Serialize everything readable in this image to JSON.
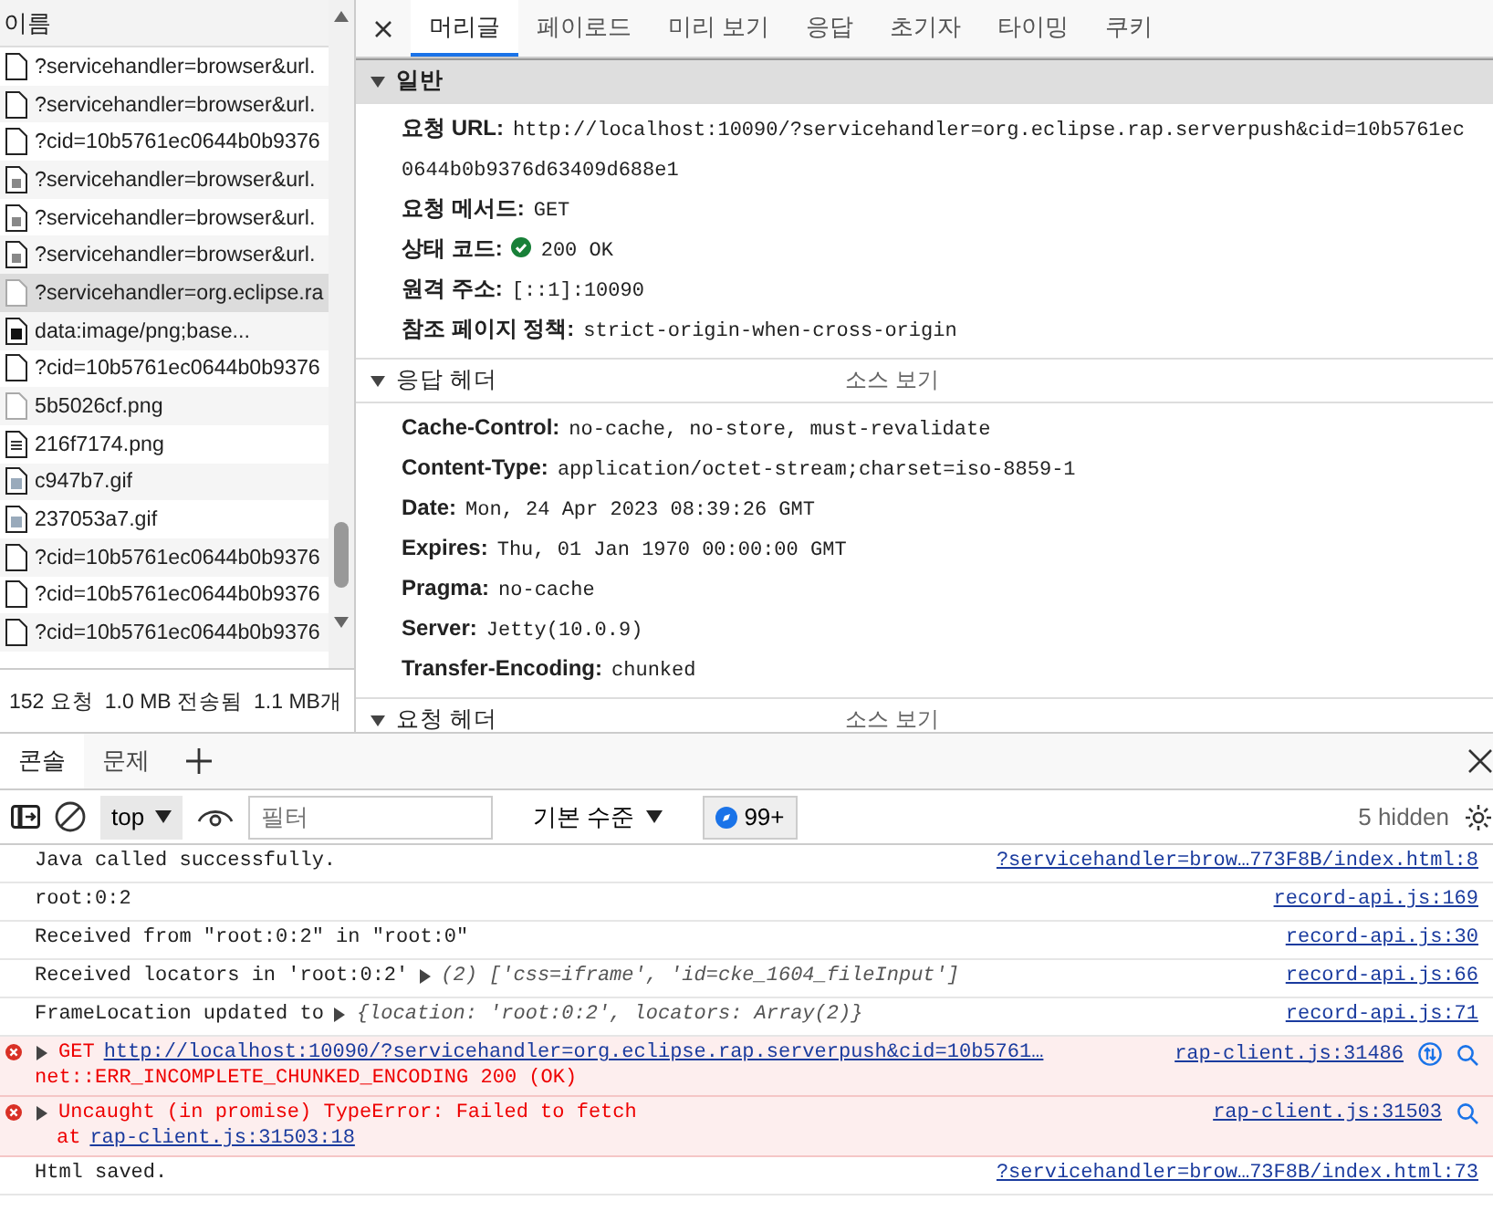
{
  "network": {
    "column_header": "이름",
    "files": [
      {
        "name": "?servicehandler=browser&url.",
        "kind": "doc",
        "selected": false
      },
      {
        "name": "?servicehandler=browser&url.",
        "kind": "doc",
        "selected": false
      },
      {
        "name": "?cid=10b5761ec0644b0b9376",
        "kind": "doc",
        "selected": false
      },
      {
        "name": "?servicehandler=browser&url.",
        "kind": "frame",
        "selected": false
      },
      {
        "name": "?servicehandler=browser&url.",
        "kind": "frame",
        "selected": false
      },
      {
        "name": "?servicehandler=browser&url.",
        "kind": "frame",
        "selected": false
      },
      {
        "name": "?servicehandler=org.eclipse.ra",
        "kind": "blank",
        "selected": true
      },
      {
        "name": "data:image/png;base...",
        "kind": "filled",
        "selected": false
      },
      {
        "name": "?cid=10b5761ec0644b0b9376",
        "kind": "doc",
        "selected": false
      },
      {
        "name": "5b5026cf.png",
        "kind": "blank",
        "selected": false
      },
      {
        "name": "216f7174.png",
        "kind": "text",
        "selected": false
      },
      {
        "name": "c947b7.gif",
        "kind": "image",
        "selected": false
      },
      {
        "name": "237053a7.gif",
        "kind": "image",
        "selected": false
      },
      {
        "name": "?cid=10b5761ec0644b0b9376",
        "kind": "doc",
        "selected": false
      },
      {
        "name": "?cid=10b5761ec0644b0b9376",
        "kind": "doc",
        "selected": false
      },
      {
        "name": "?cid=10b5761ec0644b0b9376",
        "kind": "doc",
        "selected": false
      }
    ],
    "status_bar": [
      "152 요청",
      "1.0 MB 전송됨",
      "1.1 MB개"
    ]
  },
  "details": {
    "tabs": [
      {
        "label": "머리글",
        "selected": true
      },
      {
        "label": "페이로드",
        "selected": false
      },
      {
        "label": "미리 보기",
        "selected": false
      },
      {
        "label": "응답",
        "selected": false
      },
      {
        "label": "초기자",
        "selected": false
      },
      {
        "label": "타이밍",
        "selected": false
      },
      {
        "label": "쿠키",
        "selected": false
      }
    ],
    "sections": [
      {
        "title": "일반",
        "expanded": true,
        "highlighted": true,
        "rows": [
          {
            "name": "요청 URL:",
            "value": "http://localhost:10090/?servicehandler=org.eclipse.rap.serverpush&cid=10b5761ec0644b0b9376d63409d688e1",
            "status_ok": false
          },
          {
            "name": "요청 메서드:",
            "value": "GET",
            "status_ok": false
          },
          {
            "name": "상태 코드:",
            "value": "200 OK",
            "status_ok": true
          },
          {
            "name": "원격 주소:",
            "value": "[::1]:10090",
            "status_ok": false
          },
          {
            "name": "참조 페이지 정책:",
            "value": "strict-origin-when-cross-origin",
            "status_ok": false
          }
        ]
      },
      {
        "title": "응답 헤더",
        "expanded": true,
        "highlighted": false,
        "view_source": "소스 보기",
        "rows": [
          {
            "name": "Cache-Control:",
            "value": "no-cache, no-store, must-revalidate",
            "status_ok": false
          },
          {
            "name": "Content-Type:",
            "value": "application/octet-stream;charset=iso-8859-1",
            "status_ok": false
          },
          {
            "name": "Date:",
            "value": "Mon, 24 Apr 2023 08:39:26 GMT",
            "status_ok": false
          },
          {
            "name": "Expires:",
            "value": "Thu, 01 Jan 1970 00:00:00 GMT",
            "status_ok": false
          },
          {
            "name": "Pragma:",
            "value": "no-cache",
            "status_ok": false
          },
          {
            "name": "Server:",
            "value": "Jetty(10.0.9)",
            "status_ok": false
          },
          {
            "name": "Transfer-Encoding:",
            "value": "chunked",
            "status_ok": false
          }
        ]
      },
      {
        "title": "요청 헤더",
        "expanded": true,
        "highlighted": false,
        "view_source": "소스 보기"
      }
    ]
  },
  "console": {
    "tabs": [
      {
        "label": "콘솔",
        "selected": true
      },
      {
        "label": "문제",
        "selected": false
      }
    ],
    "toolbar": {
      "context": "top",
      "filter_placeholder": "필터",
      "level": "기본 수준",
      "issues_badge": "99+",
      "hidden": "5 hidden"
    },
    "messages": [
      {
        "kind": "log",
        "text": "Java called successfully.",
        "source": "?servicehandler=brow…773F8B/index.html:8"
      },
      {
        "kind": "log",
        "text": "root:0:2",
        "source": "record-api.js:169"
      },
      {
        "kind": "log",
        "text": "Received from \"root:0:2\" in \"root:0\"",
        "source": "record-api.js:30"
      },
      {
        "kind": "log",
        "text": "Received locators in 'root:0:2'",
        "preview": "(2) ['css=iframe', 'id=cke_1604_fileInput']",
        "source": "record-api.js:66"
      },
      {
        "kind": "log",
        "text": "FrameLocation updated to",
        "preview": "{location: 'root:0:2', locators: Array(2)}",
        "source": "record-api.js:71"
      },
      {
        "kind": "error",
        "text": "GET",
        "link": "http://localhost:10090/?servicehandler=org.eclipse.rap.serverpush&cid=10b5761…",
        "line2": "net::ERR_INCOMPLETE_CHUNKED_ENCODING 200 (OK)",
        "source": "rap-client.js:31486",
        "network_icon": true
      },
      {
        "kind": "error",
        "text": "Uncaught (in promise) TypeError: Failed to fetch",
        "line2": "at",
        "line2_link": "rap-client.js:31503:18",
        "source": "rap-client.js:31503",
        "network_icon": false
      },
      {
        "kind": "log",
        "text": "Html saved.",
        "source": "?servicehandler=brow…73F8B/index.html:73"
      }
    ]
  }
}
